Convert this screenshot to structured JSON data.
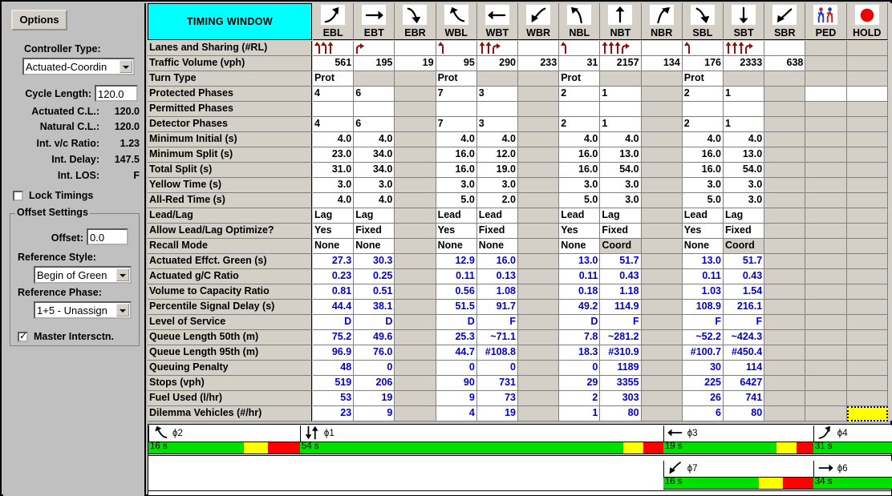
{
  "left_panel": {
    "options_button": "Options",
    "controller_type_label": "Controller Type:",
    "controller_type_value": "Actuated-Coordin",
    "cycle_length_label": "Cycle Length:",
    "cycle_length_value": "120.0",
    "actuated_cl_label": "Actuated C.L.:",
    "actuated_cl_value": "120.0",
    "natural_cl_label": "Natural C.L.:",
    "natural_cl_value": "120.0",
    "int_vc_label": "Int. v/c Ratio:",
    "int_vc_value": "1.23",
    "int_delay_label": "Int. Delay:",
    "int_delay_value": "147.5",
    "int_los_label": "Int. LOS:",
    "int_los_value": "F",
    "lock_timings_label": "Lock Timings",
    "lock_timings_checked": false,
    "offset_settings_title": "Offset Settings",
    "offset_label": "Offset:",
    "offset_value": "0.0",
    "reference_style_label": "Reference Style:",
    "reference_style_value": "Begin of Green",
    "reference_phase_label": "Reference Phase:",
    "reference_phase_value": "1+5 - Unassign",
    "master_intersection_label": "Master Intersctn.",
    "master_intersection_checked": true
  },
  "table": {
    "title": "TIMING WINDOW",
    "columns": [
      {
        "key": "EBL",
        "icon": "arrow-left-turn-up"
      },
      {
        "key": "EBT",
        "icon": "arrow-right"
      },
      {
        "key": "EBR",
        "icon": "arrow-right-turn-down"
      },
      {
        "key": "WBL",
        "icon": "arrow-left-turn-down"
      },
      {
        "key": "WBT",
        "icon": "arrow-left"
      },
      {
        "key": "WBR",
        "icon": "arrow-left-turn-up2"
      },
      {
        "key": "NBL",
        "icon": "arrow-up-turn-left"
      },
      {
        "key": "NBT",
        "icon": "arrow-up"
      },
      {
        "key": "NBR",
        "icon": "arrow-up-turn-right"
      },
      {
        "key": "SBL",
        "icon": "arrow-down-turn-right"
      },
      {
        "key": "SBT",
        "icon": "arrow-down"
      },
      {
        "key": "SBR",
        "icon": "arrow-down-turn-left"
      },
      {
        "key": "PED",
        "icon": "pedestrian-icon"
      },
      {
        "key": "HOLD",
        "icon": "red-circle-icon"
      }
    ],
    "rows": [
      {
        "label": "Lanes and Sharing (#RL)",
        "type": "lanes",
        "cells": [
          "LLT",
          "R",
          "",
          "L",
          "TTR",
          "",
          "L",
          "TTTR",
          "",
          "L",
          "TTTR",
          "",
          "GRAY",
          "GRAY"
        ]
      },
      {
        "label": "Traffic Volume (vph)",
        "type": "num",
        "cells": [
          "561",
          "195",
          "19",
          "95",
          "290",
          "233",
          "31",
          "2157",
          "134",
          "176",
          "2333",
          "638",
          "GRAY",
          "GRAY"
        ]
      },
      {
        "label": "Turn Type",
        "type": "txt",
        "cells": [
          "Prot",
          "GRAY",
          "GRAY",
          "Prot",
          "GRAY",
          "GRAY",
          "Prot",
          "GRAY",
          "GRAY",
          "Prot",
          "GRAY",
          "GRAY",
          "GRAY",
          "GRAY"
        ]
      },
      {
        "label": "Protected Phases",
        "type": "txt",
        "cells": [
          "4",
          "6",
          "GRAY",
          "7",
          "3",
          "GRAY",
          "2",
          "1",
          "GRAY",
          "2",
          "1",
          "GRAY",
          "",
          ""
        ]
      },
      {
        "label": "Permitted Phases",
        "type": "txt",
        "cells": [
          "",
          "",
          "GRAY",
          "",
          "",
          "GRAY",
          "",
          "",
          "GRAY",
          "",
          "",
          "GRAY",
          "GRAY",
          "GRAY"
        ]
      },
      {
        "label": "Detector Phases",
        "type": "txt",
        "cells": [
          "4",
          "6",
          "GRAY",
          "7",
          "3",
          "GRAY",
          "2",
          "1",
          "GRAY",
          "2",
          "1",
          "GRAY",
          "GRAY",
          "GRAY"
        ]
      },
      {
        "label": "Minimum Initial (s)",
        "type": "num",
        "cells": [
          "4.0",
          "4.0",
          "GRAY",
          "4.0",
          "4.0",
          "GRAY",
          "4.0",
          "4.0",
          "GRAY",
          "4.0",
          "4.0",
          "GRAY",
          "GRAY",
          "GRAY"
        ]
      },
      {
        "label": "Minimum Split (s)",
        "type": "num",
        "cells": [
          "23.0",
          "34.0",
          "GRAY",
          "16.0",
          "12.0",
          "GRAY",
          "16.0",
          "13.0",
          "GRAY",
          "16.0",
          "13.0",
          "GRAY",
          "GRAY",
          "GRAY"
        ]
      },
      {
        "label": "Total Split (s)",
        "type": "num",
        "cells": [
          "31.0",
          "34.0",
          "GRAY",
          "16.0",
          "19.0",
          "GRAY",
          "16.0",
          "54.0",
          "GRAY",
          "16.0",
          "54.0",
          "GRAY",
          "GRAY",
          "GRAY"
        ]
      },
      {
        "label": "Yellow Time (s)",
        "type": "num",
        "cells": [
          "3.0",
          "3.0",
          "GRAY",
          "3.0",
          "3.0",
          "GRAY",
          "3.0",
          "3.0",
          "GRAY",
          "3.0",
          "3.0",
          "GRAY",
          "GRAY",
          "GRAY"
        ]
      },
      {
        "label": "All-Red Time (s)",
        "type": "num",
        "cells": [
          "4.0",
          "4.0",
          "GRAY",
          "5.0",
          "2.0",
          "GRAY",
          "5.0",
          "3.0",
          "GRAY",
          "5.0",
          "3.0",
          "GRAY",
          "GRAY",
          "GRAY"
        ]
      },
      {
        "label": "Lead/Lag",
        "type": "txt",
        "cells": [
          "Lag",
          "Lag",
          "GRAY",
          "Lead",
          "Lead",
          "GRAY",
          "Lead",
          "Lag",
          "GRAY",
          "Lead",
          "Lag",
          "GRAY",
          "GRAY",
          "GRAY"
        ]
      },
      {
        "label": "Allow Lead/Lag Optimize?",
        "type": "txt",
        "cells": [
          "Yes",
          "Fixed",
          "GRAY",
          "Yes",
          "Fixed",
          "GRAY",
          "Yes",
          "Fixed",
          "GRAY",
          "Yes",
          "Fixed",
          "GRAY",
          "GRAY",
          "GRAY"
        ]
      },
      {
        "label": "Recall Mode",
        "type": "txt",
        "cells": [
          "None",
          "None",
          "GRAY",
          "None",
          "None",
          "GRAY",
          "None",
          "GRAY:Coord",
          "GRAY",
          "None",
          "GRAY:Coord",
          "GRAY",
          "GRAY",
          "GRAY"
        ]
      },
      {
        "label": "Actuated Effct. Green (s)",
        "type": "blue",
        "cells": [
          "27.3",
          "30.3",
          "GRAY",
          "12.9",
          "16.0",
          "GRAY",
          "13.0",
          "51.7",
          "GRAY",
          "13.0",
          "51.7",
          "GRAY",
          "GRAY",
          "GRAY"
        ]
      },
      {
        "label": "Actuated g/C Ratio",
        "type": "blue",
        "cells": [
          "0.23",
          "0.25",
          "GRAY",
          "0.11",
          "0.13",
          "GRAY",
          "0.11",
          "0.43",
          "GRAY",
          "0.11",
          "0.43",
          "GRAY",
          "GRAY",
          "GRAY"
        ]
      },
      {
        "label": "Volume to Capacity Ratio",
        "type": "blue",
        "cells": [
          "0.81",
          "0.51",
          "GRAY",
          "0.56",
          "1.08",
          "GRAY",
          "0.18",
          "1.18",
          "GRAY",
          "1.03",
          "1.54",
          "GRAY",
          "GRAY",
          "GRAY"
        ]
      },
      {
        "label": "Percentile Signal Delay (s)",
        "type": "blue",
        "cells": [
          "44.4",
          "38.1",
          "GRAY",
          "51.5",
          "91.7",
          "GRAY",
          "49.2",
          "114.9",
          "GRAY",
          "108.9",
          "216.1",
          "GRAY",
          "GRAY",
          "GRAY"
        ]
      },
      {
        "label": "Level of Service",
        "type": "blue",
        "cells": [
          "D",
          "D",
          "GRAY",
          "D",
          "F",
          "GRAY",
          "D",
          "F",
          "GRAY",
          "F",
          "F",
          "GRAY",
          "GRAY",
          "GRAY"
        ]
      },
      {
        "label": "Queue Length 50th (m)",
        "type": "blue",
        "cells": [
          "75.2",
          "49.6",
          "GRAY",
          "25.3",
          "~71.1",
          "GRAY",
          "7.8",
          "~281.2",
          "GRAY",
          "~52.2",
          "~424.3",
          "GRAY",
          "GRAY",
          "GRAY"
        ]
      },
      {
        "label": "Queue Length 95th (m)",
        "type": "blue",
        "cells": [
          "96.9",
          "76.0",
          "GRAY",
          "44.7",
          "#108.8",
          "GRAY",
          "18.3",
          "#310.9",
          "GRAY",
          "#100.7",
          "#450.4",
          "GRAY",
          "GRAY",
          "GRAY"
        ]
      },
      {
        "label": "Queuing Penalty",
        "type": "blue",
        "cells": [
          "48",
          "0",
          "GRAY",
          "0",
          "0",
          "GRAY",
          "0",
          "1189",
          "GRAY",
          "30",
          "114",
          "GRAY",
          "GRAY",
          "GRAY"
        ]
      },
      {
        "label": "Stops (vph)",
        "type": "blue",
        "cells": [
          "519",
          "206",
          "GRAY",
          "90",
          "731",
          "GRAY",
          "29",
          "3355",
          "GRAY",
          "225",
          "6427",
          "GRAY",
          "GRAY",
          "GRAY"
        ]
      },
      {
        "label": "Fuel Used (l/hr)",
        "type": "blue",
        "cells": [
          "53",
          "19",
          "GRAY",
          "9",
          "73",
          "GRAY",
          "2",
          "303",
          "GRAY",
          "26",
          "741",
          "GRAY",
          "GRAY",
          "GRAY"
        ]
      },
      {
        "label": "Dilemma Vehicles (#/hr)",
        "type": "blue",
        "cells": [
          "23",
          "9",
          "GRAY",
          "4",
          "19",
          "GRAY",
          "1",
          "80",
          "GRAY",
          "6",
          "80",
          "GRAY",
          "GRAY",
          "HILITE"
        ]
      }
    ]
  },
  "phase_diagram": {
    "colors": {
      "green": "#00e000",
      "yellow": "#ffff00",
      "red": "#ff0000"
    },
    "rows": [
      {
        "phases": [
          {
            "name": "ϕ2",
            "icon": "arrow-left-turn-down",
            "green_label": "16 s",
            "left_pct": 0.0,
            "green_pct": 12.9,
            "yellow_pct": 3.2,
            "red_pct": 4.3
          },
          {
            "name": "ϕ1",
            "icon": "arrow-down-up",
            "green_label": "54 s",
            "left_pct": 20.4,
            "green_pct": 43.5,
            "yellow_pct": 2.7,
            "red_pct": 2.7
          },
          {
            "name": "ϕ3",
            "icon": "arrow-left",
            "green_label": "19 s",
            "left_pct": 69.3,
            "green_pct": 15.3,
            "yellow_pct": 2.7,
            "red_pct": 2.2
          },
          {
            "name": "ϕ4",
            "icon": "arrow-left-turn-up",
            "green_label": "31 s",
            "left_pct": 89.5,
            "green_pct": 25.0,
            "yellow_pct": 2.7,
            "red_pct": 3.2
          }
        ]
      },
      {
        "phases": [
          {
            "name": "ϕ7",
            "icon": "arrow-left-turn-down2",
            "green_label": "16 s",
            "left_pct": 69.3,
            "green_pct": 12.9,
            "yellow_pct": 3.2,
            "red_pct": 4.3
          },
          {
            "name": "ϕ6",
            "icon": "arrow-right",
            "green_label": "34 s",
            "left_pct": 89.5,
            "green_pct": 27.4,
            "yellow_pct": 2.7,
            "red_pct": 3.2
          }
        ]
      }
    ]
  }
}
